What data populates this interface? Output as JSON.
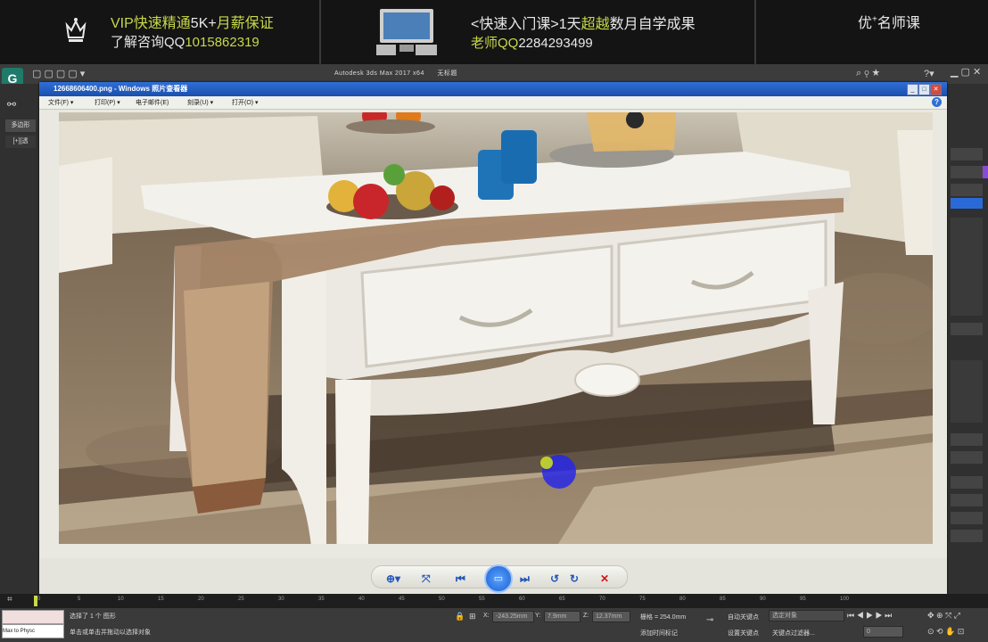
{
  "banner": {
    "vip_line1_prefix": "VIP快速精通",
    "vip_line1_highlight": "5K+",
    "vip_line1_suffix": "月薪保证",
    "vip_line2_prefix": "了解咨询QQ",
    "vip_line2_number": "1015862319",
    "course_line1_prefix": "<快速入门课>1天",
    "course_line1_highlight": "超越",
    "course_line1_suffix": "数月自学成果",
    "course_line2_prefix": "老师QQ",
    "course_line2_number": "2284293499",
    "brand_main": "优",
    "brand_sup": "+",
    "brand_rest": "名师课"
  },
  "app": {
    "title": "Autodesk 3ds Max  2017 x64",
    "doc": "无标题",
    "logo": "G",
    "left_tab1": "多边形",
    "left_tab2": "[+][透"
  },
  "viewer": {
    "title": "12668606400.png - Windows 照片查看器",
    "menu": [
      "文件(F) ▾",
      "打印(P) ▾",
      "电子邮件(E)",
      "刻录(U) ▾",
      "打开(O) ▾"
    ],
    "help": "?",
    "toolbar": {
      "zoom": "⊕▾",
      "fit": "⤧",
      "prev": "⏮",
      "play": "▭",
      "next": "⏭",
      "rotate_ccw": "↺",
      "rotate_cw": "↻",
      "delete": "✕"
    }
  },
  "timeline": {
    "ticks": [
      "0",
      "5",
      "10",
      "15",
      "20",
      "25",
      "30",
      "35",
      "40",
      "45",
      "50",
      "55",
      "60",
      "65",
      "70",
      "75",
      "80",
      "85",
      "90",
      "95",
      "100"
    ]
  },
  "status": {
    "script_label": "Max to Physc",
    "selected": "选择了 1 个 图形",
    "hint": "单击或单击并拖动以选择对象",
    "x_label": "X:",
    "x_val": "-243.25mm",
    "y_label": "Y:",
    "y_val": "7.9mm",
    "z_label": "Z:",
    "z_val": "12.37mm",
    "grid": "栅格 = 254.0mm",
    "autokey": "自动关键点",
    "setkey": "设置关键点",
    "selobj": "选定对象",
    "filter": "关键点过滤器...",
    "addtime": "添加时间标记",
    "frame": "0"
  }
}
